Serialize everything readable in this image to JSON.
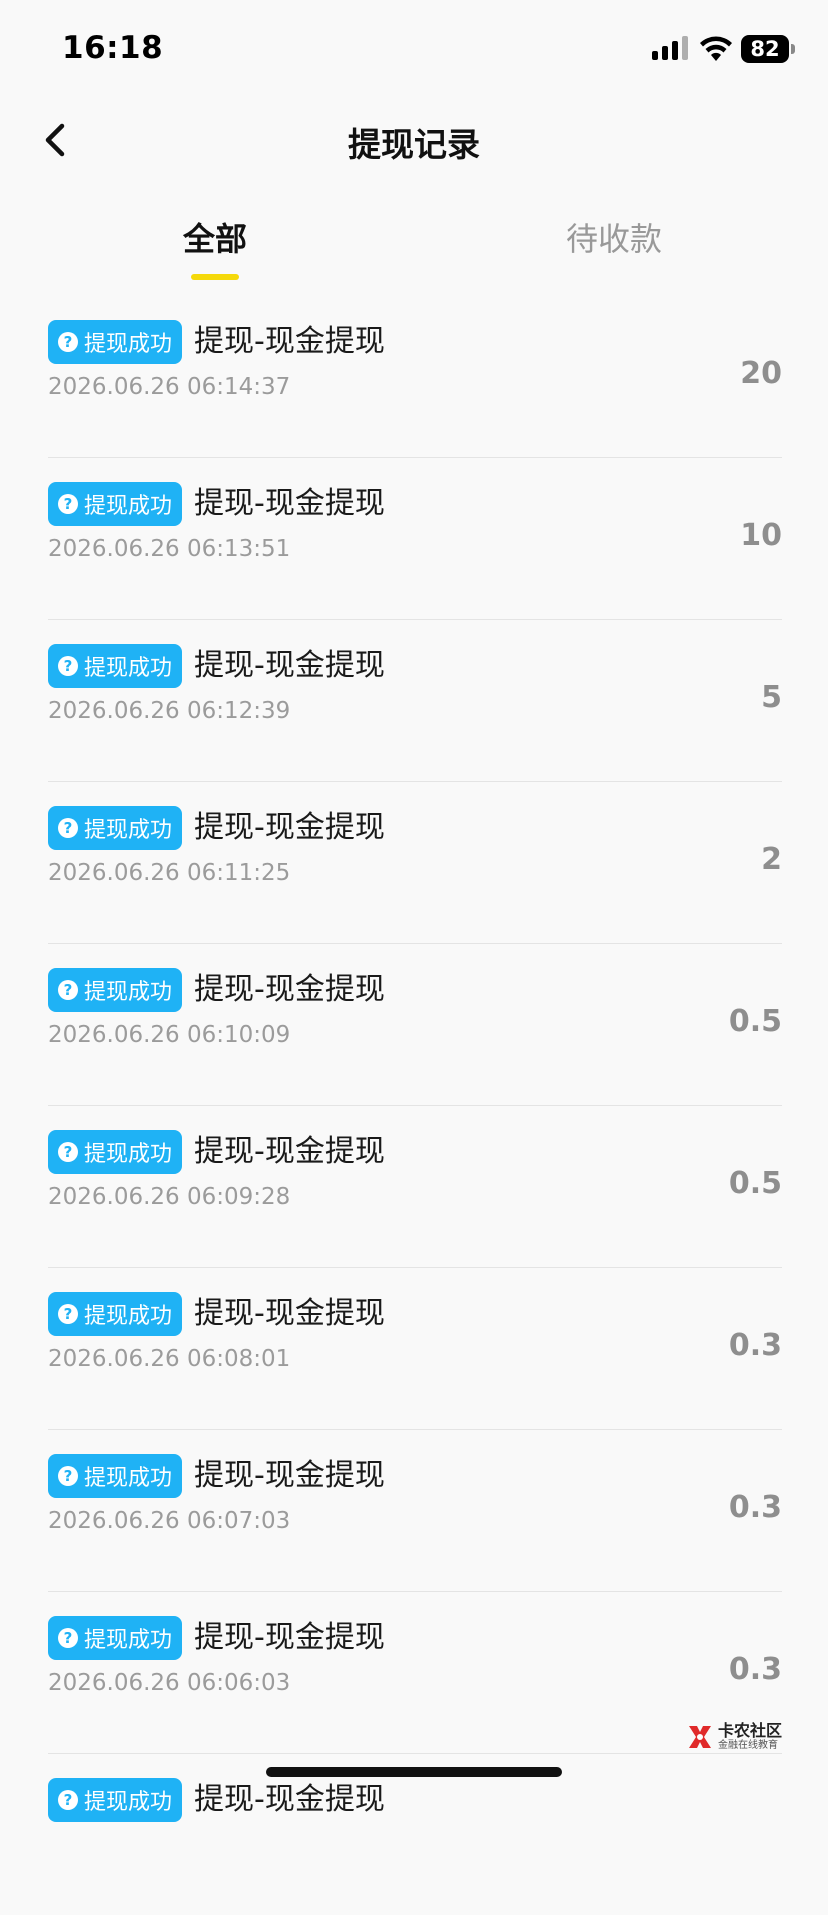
{
  "status_bar": {
    "time": "16:18",
    "battery": "82"
  },
  "header": {
    "title": "提现记录"
  },
  "tabs": [
    {
      "label": "全部",
      "active": true
    },
    {
      "label": "待收款",
      "active": false
    }
  ],
  "records": [
    {
      "badge": "提现成功",
      "title": "提现-现金提现",
      "time": "2026.06.26 06:14:37",
      "amount": "20"
    },
    {
      "badge": "提现成功",
      "title": "提现-现金提现",
      "time": "2026.06.26 06:13:51",
      "amount": "10"
    },
    {
      "badge": "提现成功",
      "title": "提现-现金提现",
      "time": "2026.06.26 06:12:39",
      "amount": "5"
    },
    {
      "badge": "提现成功",
      "title": "提现-现金提现",
      "time": "2026.06.26 06:11:25",
      "amount": "2"
    },
    {
      "badge": "提现成功",
      "title": "提现-现金提现",
      "time": "2026.06.26 06:10:09",
      "amount": "0.5"
    },
    {
      "badge": "提现成功",
      "title": "提现-现金提现",
      "time": "2026.06.26 06:09:28",
      "amount": "0.5"
    },
    {
      "badge": "提现成功",
      "title": "提现-现金提现",
      "time": "2026.06.26 06:08:01",
      "amount": "0.3"
    },
    {
      "badge": "提现成功",
      "title": "提现-现金提现",
      "time": "2026.06.26 06:07:03",
      "amount": "0.3"
    },
    {
      "badge": "提现成功",
      "title": "提现-现金提现",
      "time": "2026.06.26 06:06:03",
      "amount": "0.3"
    },
    {
      "badge": "提现成功",
      "title": "提现-现金提现",
      "time": "",
      "amount": ""
    }
  ],
  "watermark": {
    "name": "卡农社区",
    "subtitle": "金融在线教育"
  },
  "colors": {
    "accent": "#f5d90a",
    "badge": "#1fb2f5",
    "amount": "#8e8e8e"
  },
  "icons": {
    "back": "chevron-left-icon",
    "badge": "question-circle-icon"
  }
}
